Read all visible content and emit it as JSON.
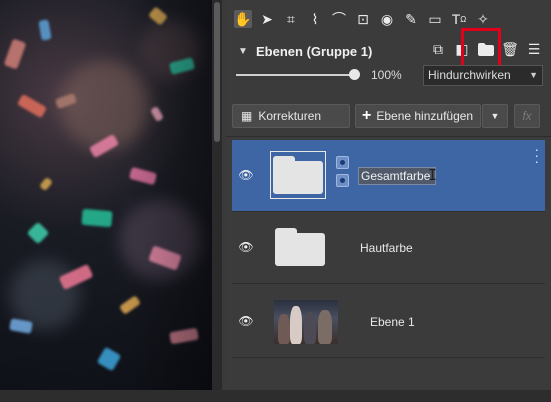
{
  "toolbar": {
    "tools": [
      "hand-icon",
      "select-arrow-icon",
      "crop-icon",
      "transform-icon",
      "warp-icon",
      "text-frame-icon",
      "eye-icon",
      "brush-icon",
      "gradient-icon",
      "text-icon",
      "sparkle-icon"
    ],
    "text_tool_glyph": "T",
    "text_tool_sub": "Ω"
  },
  "panel": {
    "title": "Ebenen (Gruppe 1)",
    "opacity": "100%",
    "blend_mode": "Hindurchwirken",
    "highlight_color": "#e3001b",
    "selection_color": "#3f66a4"
  },
  "buttons": {
    "korrekturen": "Korrekturen",
    "ebene_hinzufuegen": "Ebene hinzufügen",
    "fx": "fx"
  },
  "layers": [
    {
      "name": "Gesamtfarbe",
      "type": "group",
      "selected": true,
      "editing": true
    },
    {
      "name": "Hautfarbe",
      "type": "group",
      "selected": false,
      "editing": false
    },
    {
      "name": "Ebene 1",
      "type": "image",
      "selected": false,
      "editing": false
    }
  ]
}
